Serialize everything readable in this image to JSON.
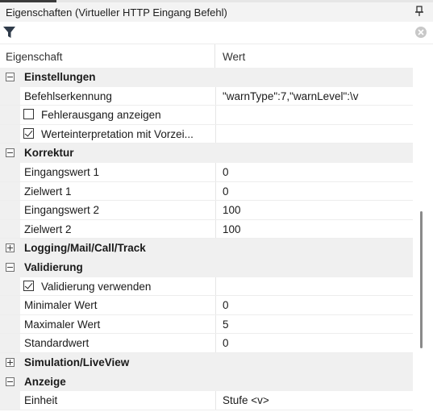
{
  "panel": {
    "title": "Eigenschaften (Virtueller HTTP Eingang Befehl)",
    "pin_icon": "pin-icon",
    "filter_icon": "filter-icon",
    "clear_icon": "clear-icon"
  },
  "columns": {
    "name": "Eigenschaft",
    "value": "Wert"
  },
  "categories": [
    {
      "label": "Einstellungen",
      "expanded": true,
      "props": [
        {
          "name": "Befehlserkennung",
          "value": "\"warnType\":7,\"warnLevel\":\\v"
        },
        {
          "name": "Fehlerausgang anzeigen",
          "value": "",
          "checkbox": true,
          "checked": false
        },
        {
          "name": "Werteinterpretation mit Vorzei...",
          "value": "",
          "checkbox": true,
          "checked": true
        }
      ]
    },
    {
      "label": "Korrektur",
      "expanded": true,
      "props": [
        {
          "name": "Eingangswert 1",
          "value": "0"
        },
        {
          "name": "Zielwert 1",
          "value": "0"
        },
        {
          "name": "Eingangswert 2",
          "value": "100"
        },
        {
          "name": "Zielwert 2",
          "value": "100"
        }
      ]
    },
    {
      "label": "Logging/Mail/Call/Track",
      "expanded": false,
      "props": []
    },
    {
      "label": "Validierung",
      "expanded": true,
      "props": [
        {
          "name": "Validierung verwenden",
          "value": "",
          "checkbox": true,
          "checked": true
        },
        {
          "name": "Minimaler Wert",
          "value": "0"
        },
        {
          "name": "Maximaler Wert",
          "value": "5"
        },
        {
          "name": "Standardwert",
          "value": "0"
        }
      ]
    },
    {
      "label": "Simulation/LiveView",
      "expanded": false,
      "props": []
    },
    {
      "label": "Anzeige",
      "expanded": true,
      "props": [
        {
          "name": "Einheit",
          "value": "Stufe <v>"
        }
      ]
    }
  ]
}
